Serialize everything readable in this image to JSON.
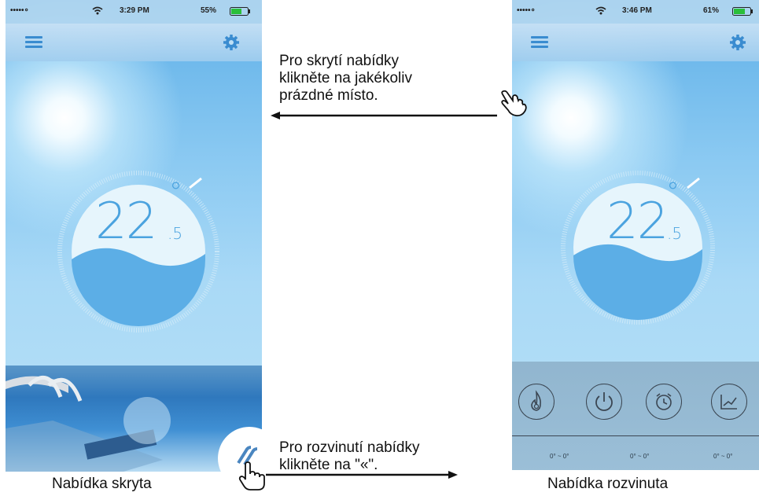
{
  "left_phone": {
    "status": {
      "carrier": "•••••∘",
      "time": "3:29 PM",
      "battery": "55%"
    },
    "temperature": {
      "whole": "22",
      "decimal": ".5",
      "degree": "°"
    },
    "expand_button": "«"
  },
  "right_phone": {
    "status": {
      "carrier": "•••••∘",
      "time": "3:46 PM",
      "battery": "61%"
    },
    "temperature": {
      "whole": "22",
      "decimal": ".5",
      "degree": "°"
    },
    "menu": {
      "icons": [
        "flame-icon",
        "power-icon",
        "alarm-clock-icon",
        "chart-icon"
      ],
      "ranges": [
        "0° ~ 0°",
        "0° ~ 0°",
        "0° ~ 0°"
      ]
    }
  },
  "annotations": {
    "hide_hint": [
      "Pro skrytí nabídky",
      "klikněte na jakékoliv",
      "prázdné místo."
    ],
    "expand_hint": [
      "Pro rozvinutí nabídky",
      "klikněte na \"«\"."
    ]
  },
  "captions": {
    "left": "Nabídka skryta",
    "right": "Nabídka rozvinuta"
  },
  "colors": {
    "accent": "#3a8cd0",
    "water": "#4ba3df",
    "sky": "#8ccaf2"
  }
}
